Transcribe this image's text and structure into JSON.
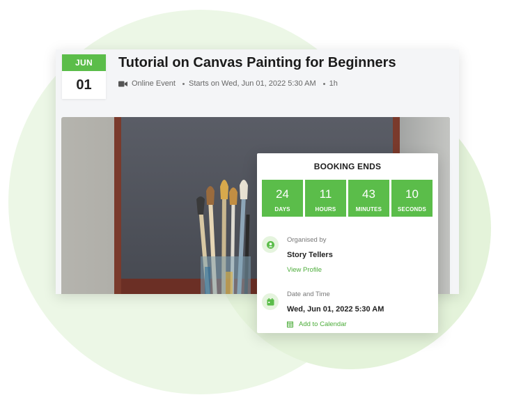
{
  "event": {
    "month": "JUN",
    "day": "01",
    "title": "Tutorial on Canvas Painting for Beginners",
    "type": "Online Event",
    "starts": "Starts on Wed, Jun 01, 2022 5:30 AM",
    "duration": "1h"
  },
  "booking": {
    "title": "BOOKING ENDS",
    "countdown": [
      {
        "value": "24",
        "label": "DAYS"
      },
      {
        "value": "11",
        "label": "HOURS"
      },
      {
        "value": "43",
        "label": "MINUTES"
      },
      {
        "value": "10",
        "label": "SECONDS"
      }
    ],
    "organiser": {
      "label": "Organised by",
      "name": "Story Tellers",
      "link": "View Profile"
    },
    "datetime": {
      "label": "Date and Time",
      "value": "Wed, Jun 01, 2022 5:30 AM",
      "link": "Add to Calendar"
    }
  },
  "icons": {
    "event_type": "video-camera-icon",
    "organiser": "user-circle-icon",
    "datetime": "calendar-icon",
    "add_calendar": "calendar-grid-icon"
  },
  "colors": {
    "accent": "#5bbd4a",
    "link": "#4cac3a",
    "circle_light": "#ecf7e6",
    "circle_mid": "#e4f3da"
  }
}
